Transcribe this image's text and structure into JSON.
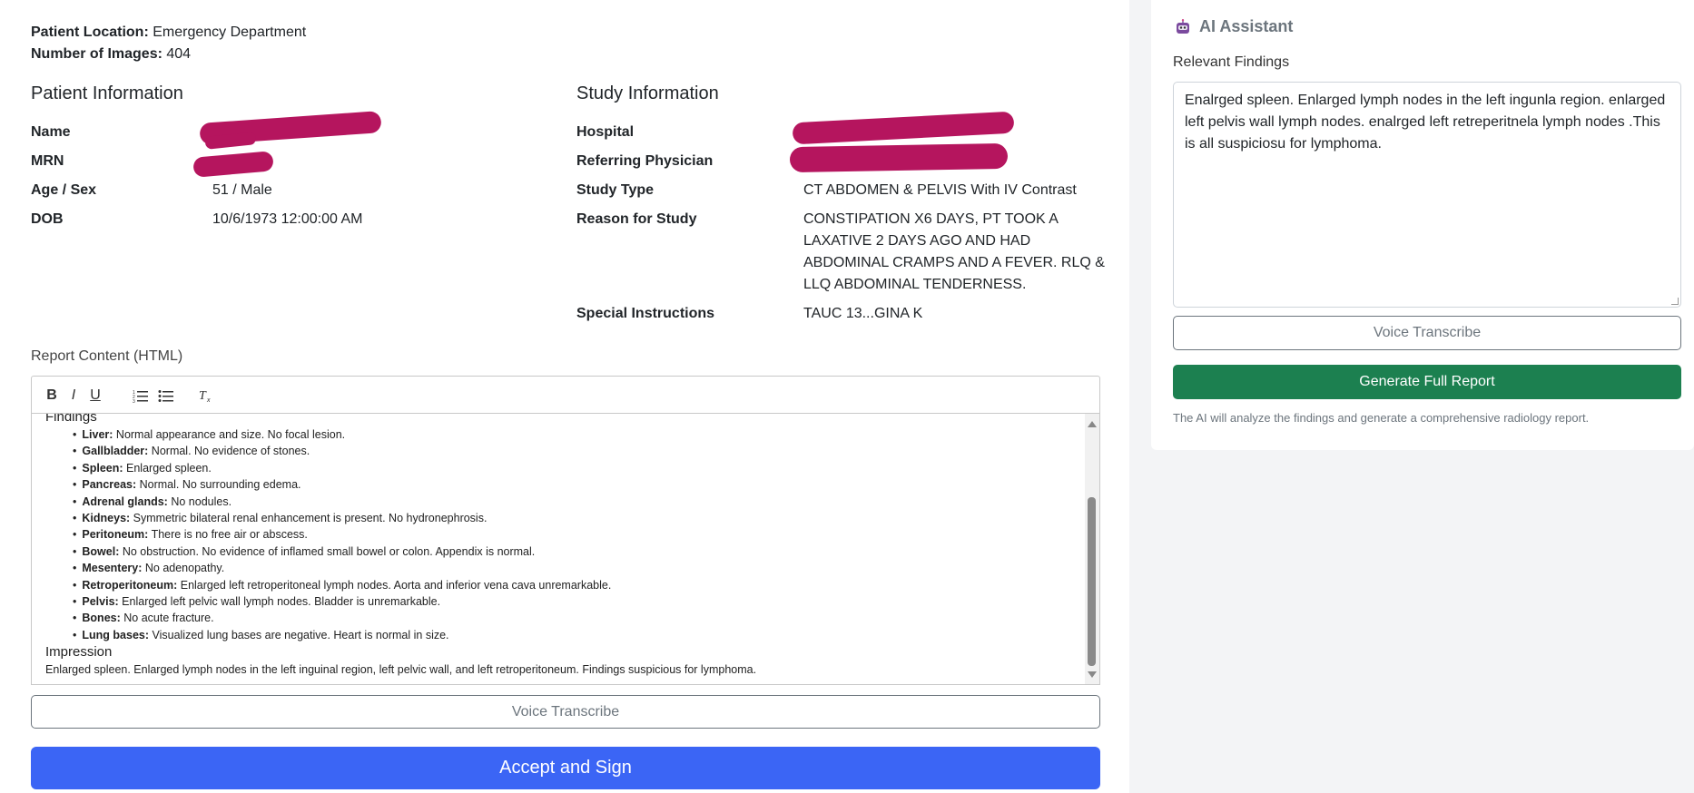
{
  "patient_meta": {
    "location_label": "Patient Location:",
    "location_value": "Emergency Department",
    "images_label": "Number of Images:",
    "images_value": "404"
  },
  "patient_info": {
    "title": "Patient Information",
    "name_label": "Name",
    "mrn_label": "MRN",
    "age_sex_label": "Age / Sex",
    "age_sex_value": "51 / Male",
    "dob_label": "DOB",
    "dob_value": "10/6/1973 12:00:00 AM"
  },
  "study_info": {
    "title": "Study Information",
    "hospital_label": "Hospital",
    "physician_label": "Referring Physician",
    "study_type_label": "Study Type",
    "study_type_value": "CT ABDOMEN & PELVIS With IV Contrast",
    "reason_label": "Reason for Study",
    "reason_line1": "CONSTIPATION X6 DAYS, PT TOOK A",
    "reason_line2": "LAXATIVE 2 DAYS AGO AND HAD",
    "reason_line3": "ABDOMINAL CRAMPS AND A FEVER. RLQ &",
    "reason_line4": "LLQ ABDOMINAL TENDERNESS.",
    "instructions_label": "Special Instructions",
    "instructions_value": "TAUC 13...GINA K"
  },
  "report": {
    "label": "Report Content (HTML)",
    "toolbar": {
      "bold": "B",
      "italic": "I",
      "underline": "U",
      "ordered": "⒈",
      "bullet": "☰",
      "clear": "Tx"
    },
    "findings_heading": "Findings",
    "findings": [
      {
        "organ": "Liver:",
        "text": " Normal appearance and size. No focal lesion."
      },
      {
        "organ": "Gallbladder:",
        "text": " Normal. No evidence of stones."
      },
      {
        "organ": "Spleen:",
        "text": " Enlarged spleen."
      },
      {
        "organ": "Pancreas:",
        "text": " Normal. No surrounding edema."
      },
      {
        "organ": "Adrenal glands:",
        "text": " No nodules."
      },
      {
        "organ": "Kidneys:",
        "text": " Symmetric bilateral renal enhancement is present. No hydronephrosis."
      },
      {
        "organ": "Peritoneum:",
        "text": " There is no free air or abscess."
      },
      {
        "organ": "Bowel:",
        "text": " No obstruction. No evidence of inflamed small bowel or colon. Appendix is normal."
      },
      {
        "organ": "Mesentery:",
        "text": " No adenopathy."
      },
      {
        "organ": "Retroperitoneum:",
        "text": " Enlarged left retroperitoneal lymph nodes. Aorta and inferior vena cava unremarkable."
      },
      {
        "organ": "Pelvis:",
        "text": " Enlarged left pelvic wall lymph nodes. Bladder is unremarkable."
      },
      {
        "organ": "Bones:",
        "text": " No acute fracture."
      },
      {
        "organ": "Lung bases:",
        "text": " Visualized lung bases are negative. Heart is normal in size."
      }
    ],
    "impression_heading": "Impression",
    "impression_text": "Enlarged spleen. Enlarged lymph nodes in the left inguinal region, left pelvic wall, and left retroperitoneum. Findings suspicious for lymphoma.",
    "voice_button": "Voice Transcribe",
    "accept_button": "Accept and Sign"
  },
  "ai": {
    "title": "AI Assistant",
    "findings_label": "Relevant Findings",
    "findings_text": "Enalrged spleen. Enlarged lymph nodes in the left ingunla region. enlarged left pelvis wall lymph nodes. enalrged left retreperitnela lymph nodes .This is all suspiciosu for lymphoma.",
    "voice_button": "Voice Transcribe",
    "generate_button": "Generate Full Report",
    "hint": "The AI will analyze the findings and generate a comprehensive radiology report."
  },
  "colors": {
    "primary": "#3b65f5",
    "success": "#1c8050",
    "redaction": "#b5155e"
  }
}
